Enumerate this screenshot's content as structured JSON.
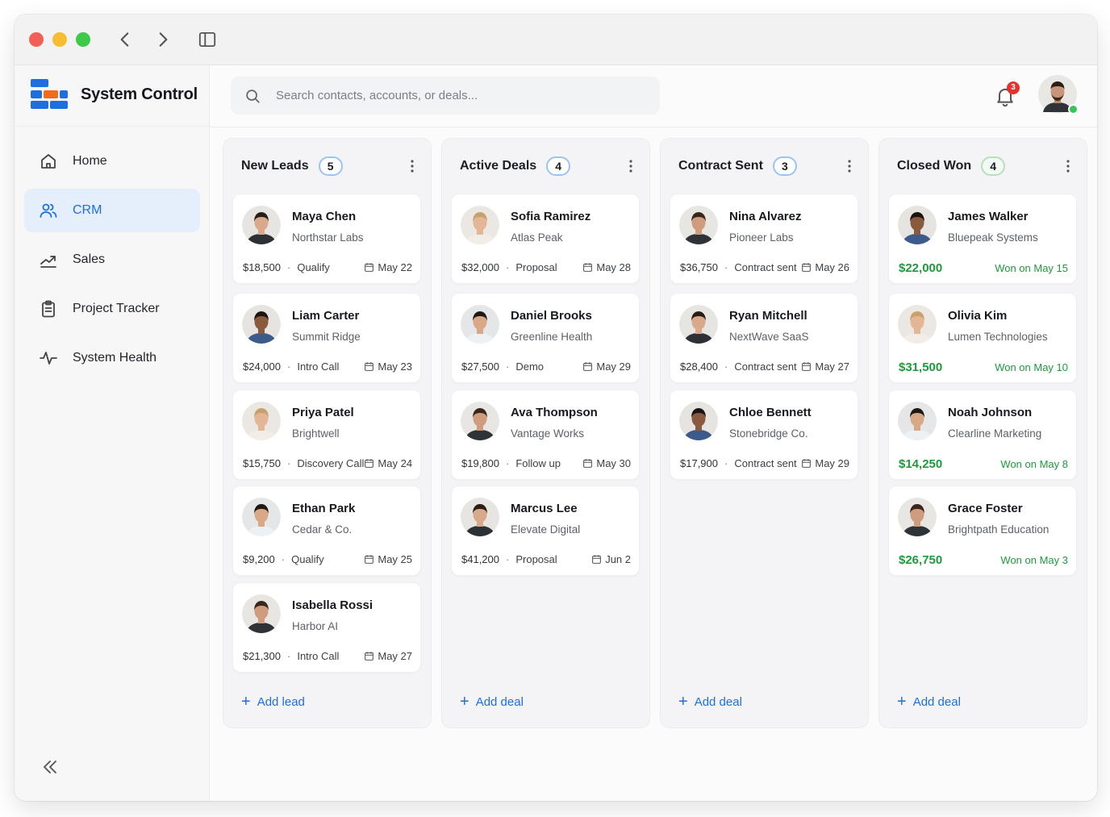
{
  "app": {
    "name": "System Control",
    "accent": "#1d6fe0",
    "success": "#1f9a3b"
  },
  "sidebar": {
    "items": [
      {
        "label": "Home",
        "icon": "home-icon",
        "active": false
      },
      {
        "label": "CRM",
        "icon": "users-icon",
        "active": true
      },
      {
        "label": "Sales",
        "icon": "trend-icon",
        "active": false
      },
      {
        "label": "Project Tracker",
        "icon": "clipboard-icon",
        "active": false
      },
      {
        "label": "System Health",
        "icon": "pulse-icon",
        "active": false
      }
    ],
    "collapse_icon": "double-chevron-left-icon"
  },
  "topbar": {
    "search_placeholder": "Search contacts, accounts, or deals...",
    "notifications_count": "3"
  },
  "columns": [
    {
      "title": "New Leads",
      "count": "5",
      "add_label": "Add lead",
      "cards": [
        {
          "name": "Maya Chen",
          "company": "Northstar Labs",
          "amount": "$18,500",
          "stage": "Qualify",
          "date": "May 22"
        },
        {
          "name": "Liam Carter",
          "company": "Summit Ridge",
          "amount": "$24,000",
          "stage": "Intro Call",
          "date": "May 23"
        },
        {
          "name": "Priya Patel",
          "company": "Brightwell",
          "amount": "$15,750",
          "stage": "Discovery Call",
          "date": "May 24"
        },
        {
          "name": "Ethan Park",
          "company": "Cedar & Co.",
          "amount": "$9,200",
          "stage": "Qualify",
          "date": "May 25"
        },
        {
          "name": "Isabella Rossi",
          "company": "Harbor AI",
          "amount": "$21,300",
          "stage": "Intro Call",
          "date": "May 27"
        }
      ]
    },
    {
      "title": "Active Deals",
      "count": "4",
      "add_label": "Add deal",
      "cards": [
        {
          "name": "Sofia Ramirez",
          "company": "Atlas Peak",
          "amount": "$32,000",
          "stage": "Proposal",
          "date": "May 28"
        },
        {
          "name": "Daniel Brooks",
          "company": "Greenline Health",
          "amount": "$27,500",
          "stage": "Demo",
          "date": "May 29"
        },
        {
          "name": "Ava Thompson",
          "company": "Vantage Works",
          "amount": "$19,800",
          "stage": "Follow up",
          "date": "May 30"
        },
        {
          "name": "Marcus Lee",
          "company": "Elevate Digital",
          "amount": "$41,200",
          "stage": "Proposal",
          "date": "Jun 2"
        }
      ]
    },
    {
      "title": "Contract Sent",
      "count": "3",
      "add_label": "Add deal",
      "cards": [
        {
          "name": "Nina Alvarez",
          "company": "Pioneer Labs",
          "amount": "$36,750",
          "stage": "Contract sent",
          "date": "May 26"
        },
        {
          "name": "Ryan Mitchell",
          "company": "NextWave SaaS",
          "amount": "$28,400",
          "stage": "Contract sent",
          "date": "May 27"
        },
        {
          "name": "Chloe Bennett",
          "company": "Stonebridge Co.",
          "amount": "$17,900",
          "stage": "Contract sent",
          "date": "May 29"
        }
      ]
    },
    {
      "title": "Closed Won",
      "count": "4",
      "add_label": "Add deal",
      "cards": [
        {
          "name": "James Walker",
          "company": "Bluepeak Systems",
          "amount": "$22,000",
          "won": "Won on May 15"
        },
        {
          "name": "Olivia Kim",
          "company": "Lumen Technologies",
          "amount": "$31,500",
          "won": "Won on May 10"
        },
        {
          "name": "Noah Johnson",
          "company": "Clearline Marketing",
          "amount": "$14,250",
          "won": "Won on May 8"
        },
        {
          "name": "Grace Foster",
          "company": "Brightpath Education",
          "amount": "$26,750",
          "won": "Won on May 3"
        }
      ]
    }
  ]
}
